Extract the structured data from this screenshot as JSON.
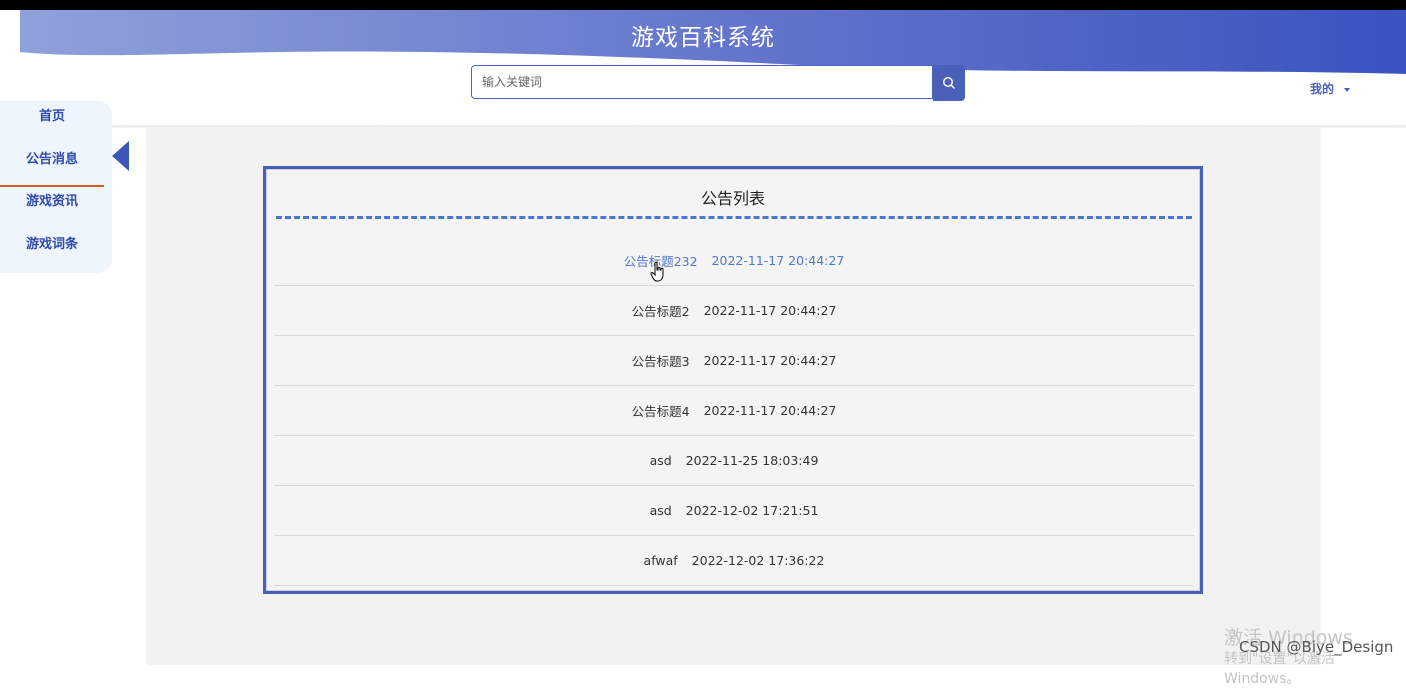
{
  "header": {
    "title": "游戏百科系统",
    "search_placeholder": "输入关键词",
    "user_menu_label": "我的",
    "brand_color": "#4a5fb8"
  },
  "sidebar": {
    "items": [
      {
        "label": "首页",
        "active": false
      },
      {
        "label": "公告消息",
        "active": true
      },
      {
        "label": "游戏资讯",
        "active": false
      },
      {
        "label": "游戏词条",
        "active": false
      }
    ],
    "active_indicator_color": "#d9582b"
  },
  "panel": {
    "title": "公告列表",
    "rows": [
      {
        "title": "公告标题232",
        "time": "2022-11-17 20:44:27",
        "hover": true
      },
      {
        "title": "公告标题2",
        "time": "2022-11-17 20:44:27",
        "hover": false
      },
      {
        "title": "公告标题3",
        "time": "2022-11-17 20:44:27",
        "hover": false
      },
      {
        "title": "公告标题4",
        "time": "2022-11-17 20:44:27",
        "hover": false
      },
      {
        "title": "asd",
        "time": "2022-11-25 18:03:49",
        "hover": false
      },
      {
        "title": "asd",
        "time": "2022-12-02 17:21:51",
        "hover": false
      },
      {
        "title": "afwaf",
        "time": "2022-12-02 17:36:22",
        "hover": false
      }
    ]
  },
  "overlay": {
    "windows_activate_line1": "激活 Windows",
    "windows_activate_line2": "转到\"设置\"以激活 Windows。",
    "csdn_watermark": "CSDN @Biye_Design"
  }
}
